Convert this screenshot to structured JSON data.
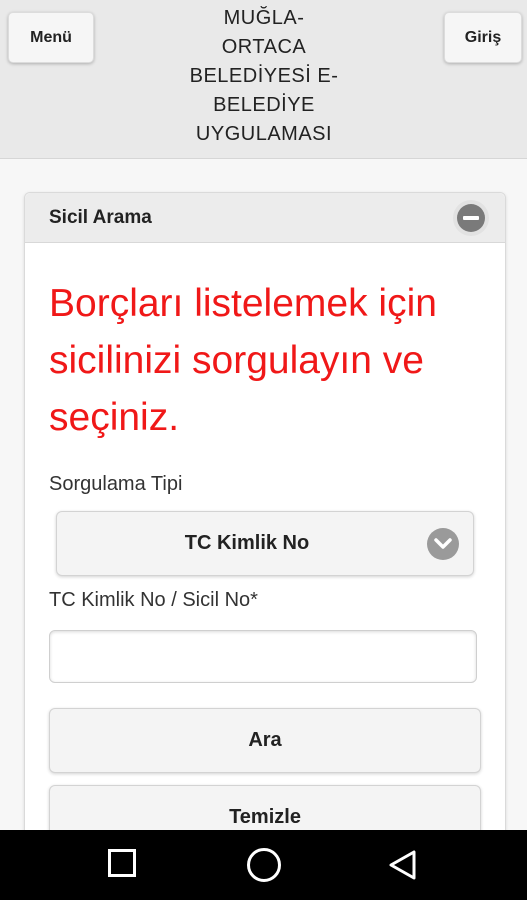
{
  "header": {
    "menu_label": "Menü",
    "login_label": "Giriş",
    "title_lines": [
      "MUĞLA-",
      "ORTACA",
      "BELEDİYESİ E-",
      "BELEDİYE",
      "UYGULAMASI"
    ]
  },
  "panel": {
    "title": "Sicil Arama",
    "collapse_icon": "minus-circle-icon",
    "notice": "Borçları listelemek için sicilinizi sorgulayın ve seçiniz.",
    "notice_color": "#f01818",
    "query_type_label": "Sorgulama Tipi",
    "query_type_selected": "TC Kimlik No",
    "id_field_label": "TC Kimlik No / Sicil No*",
    "id_field_value": "",
    "search_button": "Ara",
    "clear_button": "Temizle"
  },
  "navbar": {
    "icons": [
      "recents-square-icon",
      "home-circle-icon",
      "back-triangle-icon"
    ]
  }
}
